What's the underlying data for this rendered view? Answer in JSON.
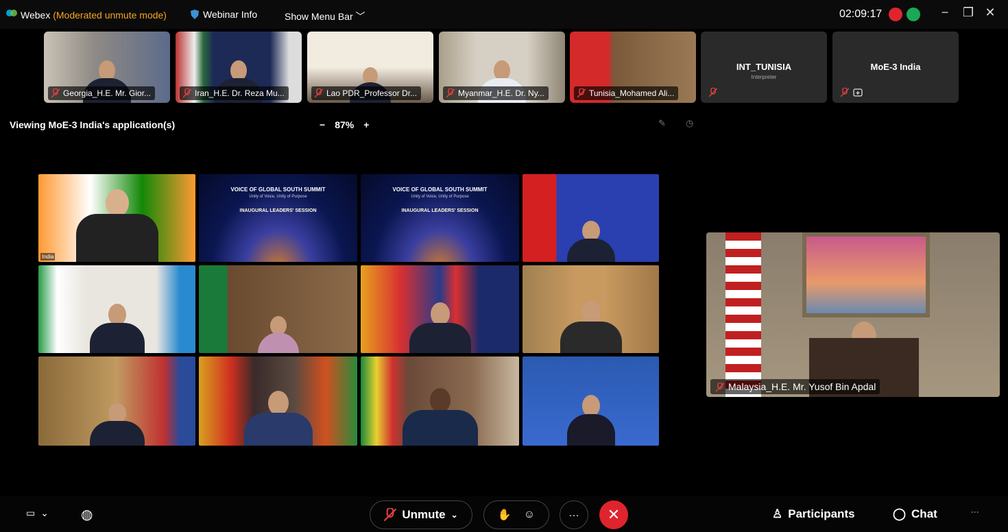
{
  "window": {
    "app_name": "Webex",
    "mode": "(Moderated unmute mode)",
    "webinar_info": "Webinar Info",
    "show_menu_bar": "Show Menu Bar",
    "timer": "02:09:17",
    "accent_color": "#00a0d1",
    "status_colors": [
      "#e0242d",
      "#1aaa55"
    ]
  },
  "participants_strip": [
    {
      "label": "Georgia_H.E. Mr. Gior..."
    },
    {
      "label": "Iran_H.E. Dr. Reza Mu..."
    },
    {
      "label": "Lao PDR_Professor Dr..."
    },
    {
      "label": "Myanmar_H.E. Dr. Ny..."
    },
    {
      "label": "Tunisia_Mohamed Ali..."
    },
    {
      "name": "INT_TUNISIA",
      "role": "Interpreter"
    },
    {
      "name": "MoE-3 India"
    }
  ],
  "share": {
    "viewing_text": "Viewing MoE-3 India's application(s)",
    "zoom_minus": "−",
    "zoom_level": "87%",
    "zoom_plus": "+"
  },
  "grid": {
    "india_tag": "India",
    "summit_title": "VOICE OF GLOBAL SOUTH SUMMIT",
    "summit_subtitle": "Unity of Voice, Unity of Purpose",
    "summit_session": "INAUGURAL LEADERS' SESSION"
  },
  "active_speaker": {
    "label": "Malaysia_H.E. Mr. Yusof Bin Apdal"
  },
  "controls": {
    "unmute_label": "Unmute",
    "end_icon": "✕",
    "more_icon": "···",
    "participants_label": "Participants",
    "chat_label": "Chat",
    "overflow_icon": "···"
  }
}
